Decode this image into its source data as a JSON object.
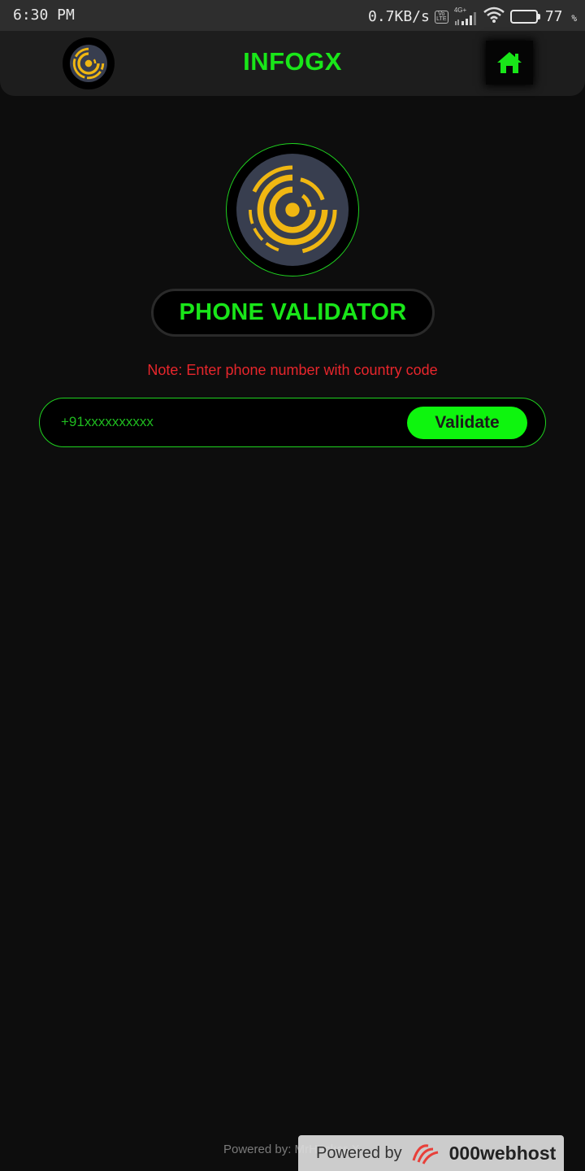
{
  "status_bar": {
    "time": "6:30 PM",
    "net_speed": "0.7KB/s",
    "volte": "Vo LTE",
    "network_type": "4G+",
    "battery_level": 77,
    "battery_pct": "77",
    "battery_unit": "%"
  },
  "header": {
    "title": "INFOGX",
    "logo_icon": "infogx-logo-icon",
    "home_icon": "home-icon"
  },
  "main": {
    "page_title": "PHONE VALIDATOR",
    "note": "Note: Enter phone number with country code",
    "phone_input": {
      "placeholder": "+91xxxxxxxxxx",
      "value": ""
    },
    "validate_label": "Validate"
  },
  "footer": {
    "powered_text": "Powered by: MrHacker-X",
    "webhost_powered": "Powered by",
    "webhost_name": "000webhost"
  },
  "colors": {
    "accent_green": "#19e619",
    "button_green": "#0ef50e",
    "note_red": "#e8262c",
    "logo_gold": "#f0b712",
    "background": "#0d0d0d"
  }
}
